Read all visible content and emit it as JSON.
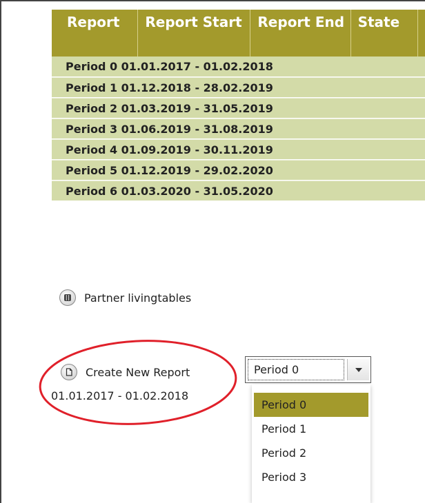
{
  "table": {
    "headers": [
      "Report",
      "Report Start",
      "Report End",
      "State",
      ""
    ],
    "rows": [
      "Period 0 01.01.2017 - 01.02.2018",
      "Period 1 01.12.2018 - 28.02.2019",
      "Period 2 01.03.2019 - 31.05.2019",
      "Period 3 01.06.2019 - 31.08.2019",
      "Period 4 01.09.2019 - 30.11.2019",
      "Period 5 01.12.2019 - 29.02.2020",
      "Period 6 01.03.2020 - 31.05.2020"
    ]
  },
  "partner": {
    "label": "Partner livingtables",
    "icon": "table-icon"
  },
  "create": {
    "label": "Create New Report",
    "icon": "document-icon",
    "range": "01.01.2017 - 01.02.2018"
  },
  "select": {
    "value": "Period 0",
    "options": [
      "Period 0",
      "Period 1",
      "Period 2",
      "Period 3"
    ]
  },
  "colors": {
    "header": "#a39a2c",
    "row": "#d3dba8",
    "highlight": "#a39a2c",
    "annotation": "#e0202a"
  }
}
